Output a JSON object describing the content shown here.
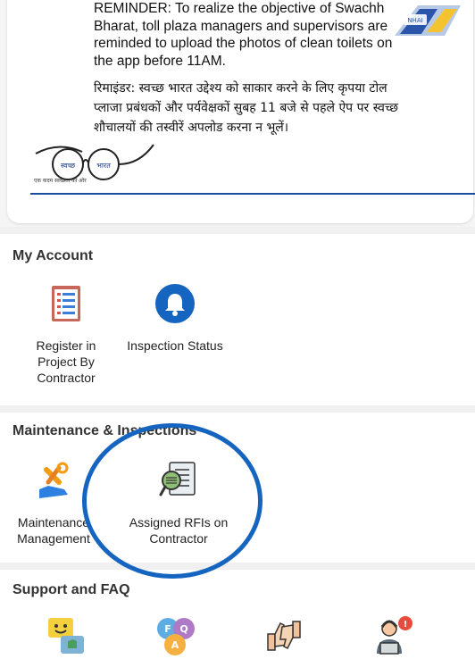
{
  "banner": {
    "reminder_en": "REMINDER: To realize the objective of Swachh Bharat, toll plaza managers and supervisors are reminded to upload the photos of clean toilets on the app before 11AM.",
    "reminder_hi": "रिमाइंडर: स्वच्छ भारत उद्देश्य को साकार करने के लिए कृपया टोल प्लाजा प्रबंधकों और पर्यवेक्षकों सुबह 11 बजे से पहले ऐप पर स्वच्छ शौचालयों की तस्वीरें अपलोड करना न भूलें।",
    "logo_left": "स्वच्छ",
    "logo_right": "भारत",
    "tagline": "एक कदम स्वच्छता की ओर"
  },
  "my_account": {
    "title": "My Account",
    "tiles": [
      {
        "label": "Register in Project By Contractor",
        "icon": "document-list-icon"
      },
      {
        "label": "Inspection Status",
        "icon": "bell-icon"
      }
    ]
  },
  "maintenance": {
    "title": "Maintenance & Inspections",
    "tiles": [
      {
        "label": "Maintenance Management",
        "icon": "tools-icon"
      },
      {
        "label": "Assigned RFIs on Contractor",
        "icon": "document-search-icon"
      }
    ]
  },
  "support": {
    "title": "Support and FAQ",
    "tiles": [
      {
        "icon": "feedback-chat-icon"
      },
      {
        "icon": "faq-icon"
      },
      {
        "icon": "thumbs-rating-icon"
      },
      {
        "icon": "helpdesk-icon"
      }
    ]
  },
  "colors": {
    "accent_blue": "#1565c0",
    "bell_blue": "#1565c0",
    "annotation": "#1565c0"
  }
}
